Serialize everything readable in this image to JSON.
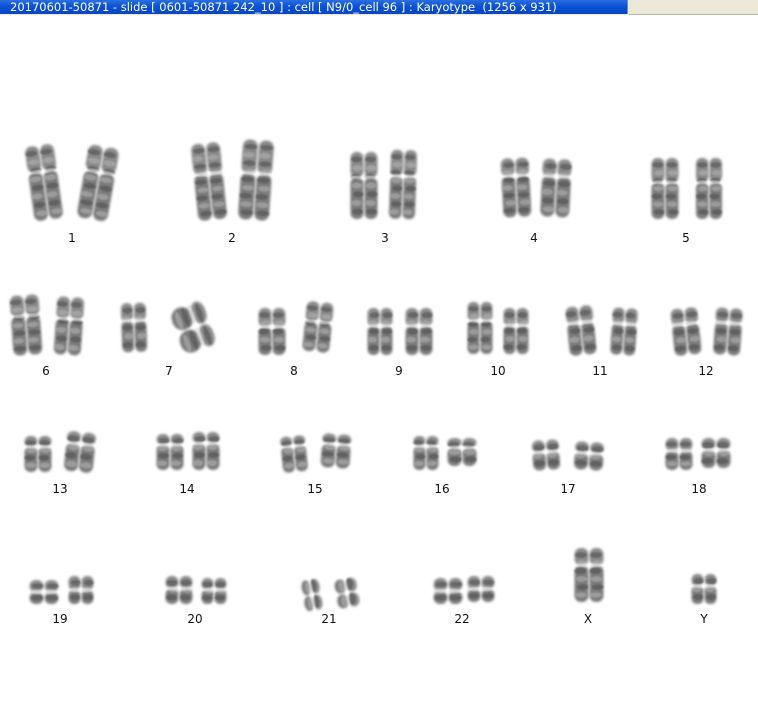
{
  "window": {
    "title": "20170601-50871 - slide [ 0601-50871 242_10 ] : cell [ N9/0_cell 96 ] : Karyotype  (1256 x 931)"
  },
  "karyotype": {
    "pairs": [
      {
        "label": "1"
      },
      {
        "label": "2"
      },
      {
        "label": "3"
      },
      {
        "label": "4"
      },
      {
        "label": "5"
      },
      {
        "label": "6"
      },
      {
        "label": "7"
      },
      {
        "label": "8"
      },
      {
        "label": "9"
      },
      {
        "label": "10"
      },
      {
        "label": "11"
      },
      {
        "label": "12"
      },
      {
        "label": "13"
      },
      {
        "label": "14"
      },
      {
        "label": "15"
      },
      {
        "label": "16"
      },
      {
        "label": "17"
      },
      {
        "label": "18"
      },
      {
        "label": "19"
      },
      {
        "label": "20"
      },
      {
        "label": "21"
      },
      {
        "label": "22"
      },
      {
        "label": "X"
      },
      {
        "label": "Y"
      }
    ]
  }
}
